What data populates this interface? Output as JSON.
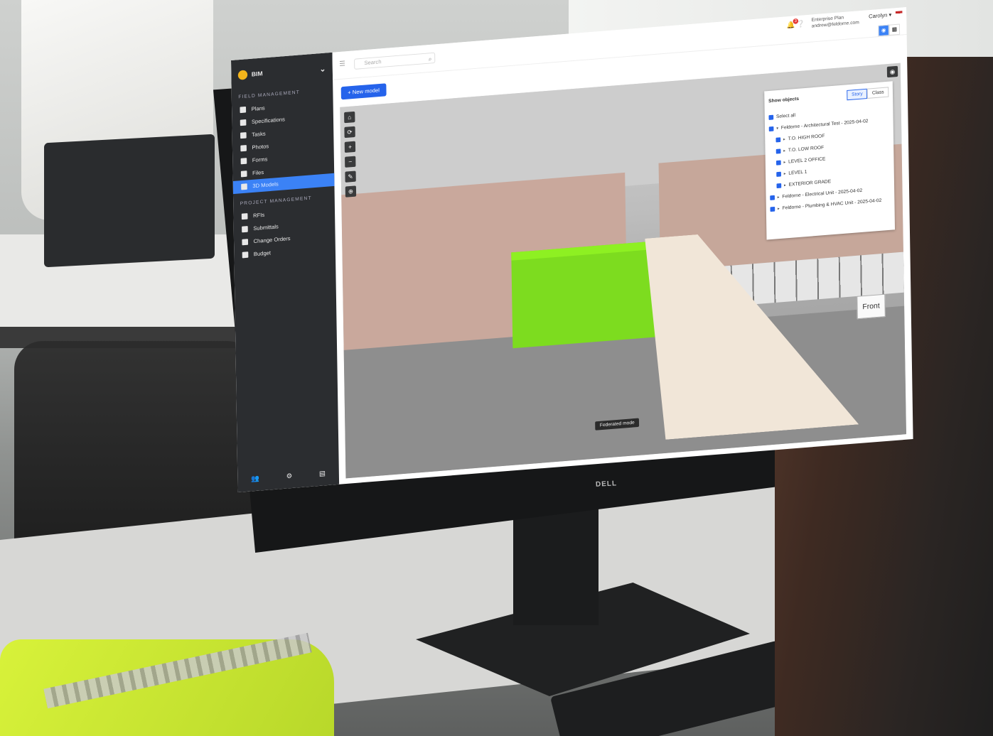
{
  "app": {
    "module": "BIM",
    "new_model_label": "+ New model",
    "search_placeholder": "Search",
    "notification_count": "3",
    "plan_label": "Enterprise Plan",
    "plan_email": "andrew@feldorne.com",
    "user_name": "Carolyn ▾"
  },
  "sidebar": {
    "field_section": "FIELD MANAGEMENT",
    "field_items": [
      {
        "label": "Plans"
      },
      {
        "label": "Specifications"
      },
      {
        "label": "Tasks"
      },
      {
        "label": "Photos"
      },
      {
        "label": "Forms"
      },
      {
        "label": "Files"
      },
      {
        "label": "3D Models"
      }
    ],
    "project_section": "PROJECT MANAGEMENT",
    "project_items": [
      {
        "label": "RFIs"
      },
      {
        "label": "Submittals"
      },
      {
        "label": "Change Orders"
      },
      {
        "label": "Budget"
      }
    ],
    "active_item": "3D Models"
  },
  "panel": {
    "title": "Show objects",
    "tabs": [
      "Story",
      "Class"
    ],
    "active_tab": "Story",
    "select_all": "Select all",
    "models": [
      {
        "label": "Feldorne - Architectural Test - 2025-04-02",
        "stories": [
          "T.O. HIGH ROOF",
          "T.O. LOW ROOF",
          "LEVEL 2 OFFICE",
          "LEVEL 1",
          "EXTERIOR GRADE"
        ]
      },
      {
        "label": "Feldorne - Electrical Unit - 2025-04-02",
        "stories": []
      },
      {
        "label": "Feldorne - Plumbing & HVAC Unit - 2025-04-02",
        "stories": []
      }
    ]
  },
  "viewer": {
    "front_label": "Front",
    "mode_label": "Federated mode"
  },
  "monitor": {
    "brand": "DELL"
  },
  "colors": {
    "accent": "#3b82f6",
    "highlight_object": "#7ddc1f",
    "sidebar_bg": "#2b2d30"
  }
}
